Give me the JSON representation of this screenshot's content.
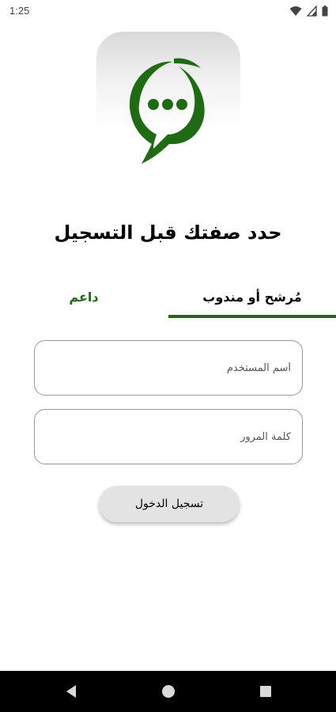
{
  "status_bar": {
    "time": "1:25",
    "icons": [
      "wifi-icon",
      "signal-icon",
      "battery-icon"
    ]
  },
  "logo": {
    "icon": "chat-bubble-icon",
    "accent_color": "#1f6b14"
  },
  "title": "حدد صفتك قبل التسجيل",
  "tabs": [
    {
      "label": "مُرشح أو مندوب",
      "selected": true
    },
    {
      "label": "داعم",
      "selected": false
    }
  ],
  "form": {
    "username_placeholder": "أسم المستخدم",
    "username_value": "",
    "password_placeholder": "كلمة المرور",
    "password_value": ""
  },
  "login_button": "تسجيل الدخول",
  "nav_bar": {
    "icons": [
      "back-icon",
      "home-icon",
      "recents-icon"
    ]
  },
  "colors": {
    "brand_green": "#1f6b14",
    "button_bg": "#e3e3e3"
  }
}
